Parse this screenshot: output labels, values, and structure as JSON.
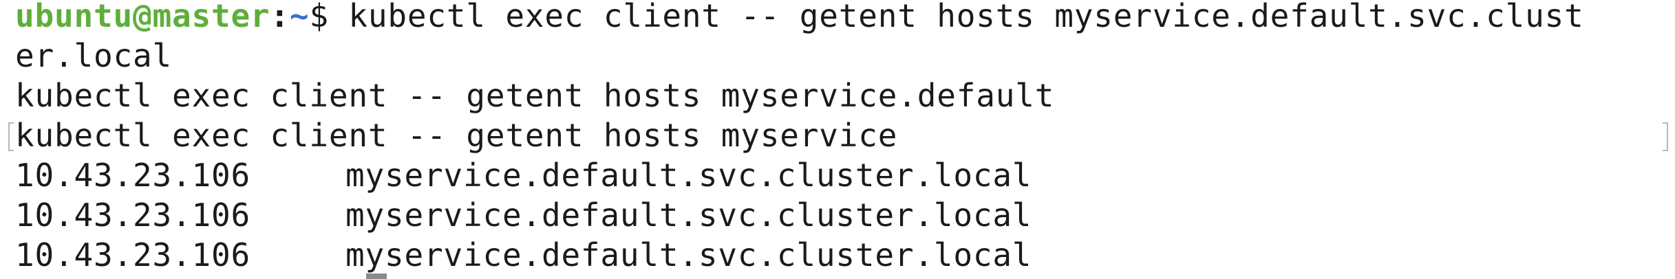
{
  "terminal": {
    "prompt": {
      "user_host": "ubuntu@master",
      "separator": ":",
      "path": "~",
      "symbol": "$"
    },
    "command": " kubectl exec client -- getent hosts myservice.default.svc.clust",
    "command_wrap": "er.local",
    "history_lines": [
      "kubectl exec client -- getent hosts myservice.default",
      "kubectl exec client -- getent hosts myservice"
    ],
    "output": [
      {
        "ip": "10.43.23.106",
        "host": "myservice.default.svc.cluster.local"
      },
      {
        "ip": "10.43.23.106",
        "host": "myservice.default.svc.cluster.local"
      },
      {
        "ip": "10.43.23.106",
        "host": "myservice.default.svc.cluster.local"
      }
    ],
    "colors": {
      "background": "#ffffff",
      "text": "#1a1a1a",
      "user_host": "#5fae3c",
      "path": "#3a6fd8"
    }
  }
}
